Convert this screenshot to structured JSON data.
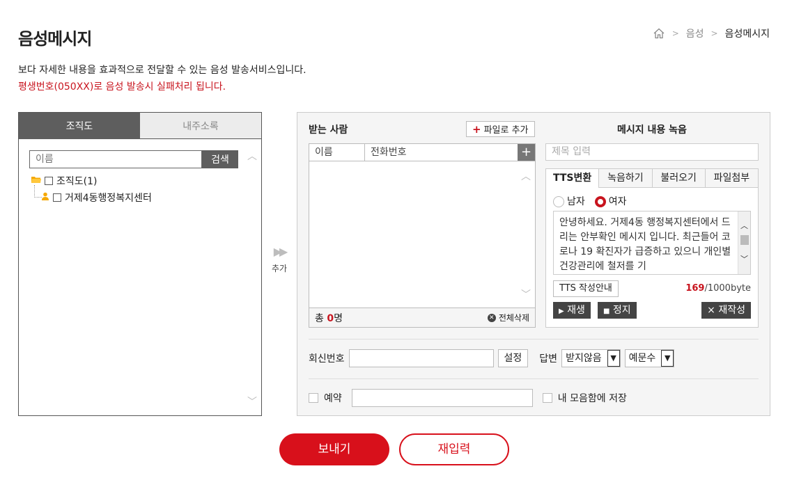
{
  "header": {
    "title": "음성메시지",
    "breadcrumb": [
      "음성",
      "음성메시지"
    ],
    "description": "보다 자세한 내용을 효과적으로 전달할 수 있는 음성 발송서비스입니다.",
    "warning": "평생번호(050XX)로 음성 발송시 실패처리 됩니다."
  },
  "left": {
    "tabs": [
      "조직도",
      "내주소록"
    ],
    "search_placeholder": "이름",
    "search_button": "검색",
    "tree": [
      {
        "label": "조직도(1)"
      },
      {
        "label": "거제4동행정복지센터"
      }
    ]
  },
  "add": {
    "label": "추가"
  },
  "recipients": {
    "title": "받는 사람",
    "file_add": "파일로 추가",
    "col_name": "이름",
    "col_phone": "전화번호",
    "total_prefix": "총",
    "total_count": "0",
    "total_suffix": "명",
    "delete_all": "전체삭제"
  },
  "message": {
    "title": "메시지 내용 녹음",
    "subject_placeholder": "제목 입력",
    "tabs": [
      "TTS변환",
      "녹음하기",
      "불러오기",
      "파일첨부"
    ],
    "gender_male": "남자",
    "gender_female": "여자",
    "selected_gender": "여자",
    "tts_text": "안녕하세요. 거제4동 행정복지센터에서 드리는 안부확인 메시지 입니다. 최근들어 코로나 19 확진자가 급증하고 있으니 개인별 건강관리에 철저를 기",
    "tts_guide": "TTS 작성안내",
    "byte_used": "169",
    "byte_limit": "/1000byte",
    "play": "재생",
    "stop": "정지",
    "regenerate": "재작성"
  },
  "options": {
    "reply_label": "회신번호",
    "reply_set": "설정",
    "answer_label": "답변",
    "answer_value": "받지않음",
    "count_value": "예문수",
    "reserve_label": "예약",
    "save_label": "내 모음함에 저장"
  },
  "actions": {
    "send": "보내기",
    "reset": "재입력"
  },
  "colors": {
    "accent": "#d8101b",
    "dark": "#5e5e5e"
  }
}
